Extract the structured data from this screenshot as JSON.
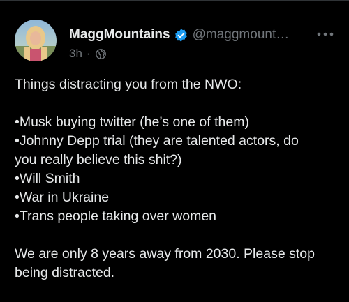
{
  "tweet": {
    "display_name": "MaggMountains",
    "handle": "@maggmount…",
    "time": "3h",
    "separator": "·",
    "icons": {
      "verified": "verified-badge-icon",
      "visibility": "globe-icon",
      "more": "more-options-icon"
    },
    "colors": {
      "background": "#000000",
      "text": "#e7e9ea",
      "secondary": "#71767b",
      "verified": "#1d9bf0"
    },
    "lines": {
      "intro": "Things distracting you from the NWO:",
      "item1": "•Musk buying twitter (he’s one of them)",
      "item2a": "•Johnny Depp trial (they are talented actors, do",
      "item2b": "you really believe this shit?)",
      "item3": "•Will Smith",
      "item4": "•War in Ukraine",
      "item5": "•Trans people taking over women",
      "outro_a": "We are only 8 years away from 2030. Please stop",
      "outro_b": "being distracted."
    }
  }
}
